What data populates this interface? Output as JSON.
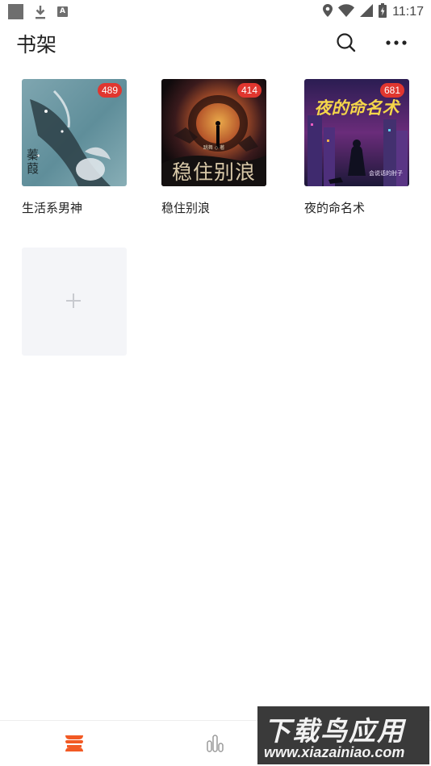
{
  "status_bar": {
    "time": "11:17",
    "left_icons": [
      "square-icon",
      "download-icon",
      "a-icon"
    ],
    "right_icons": [
      "location-icon",
      "wifi-icon",
      "signal-icon",
      "battery-icon"
    ],
    "a_glyph": "A"
  },
  "header": {
    "title": "书架",
    "search_icon": "search-icon",
    "more_icon": "more-icon"
  },
  "books": [
    {
      "title": "生活系男神",
      "count": "489",
      "cover_text": "蓁葭"
    },
    {
      "title": "稳住别浪",
      "count": "414",
      "cover_text": "稳住别浪",
      "cover_author": "跳舞 ◇ 著"
    },
    {
      "title": "夜的命名术",
      "count": "681",
      "cover_text": "夜的命名术",
      "cover_author": "会说话的肘子"
    }
  ],
  "add_book": {
    "icon": "plus-icon"
  },
  "bottom_nav": {
    "items": [
      {
        "icon": "bookshelf-icon",
        "active": true,
        "color": "#f25a24"
      },
      {
        "icon": "rank-chart-icon",
        "active": false,
        "color": "#9a9a9a"
      }
    ]
  },
  "watermark": {
    "title": "下载鸟应用",
    "url": "www.xiazainiao.com"
  },
  "colors": {
    "accent": "#f25a24",
    "badge": "#e0362f",
    "add_tile_bg": "#f4f5f8"
  }
}
